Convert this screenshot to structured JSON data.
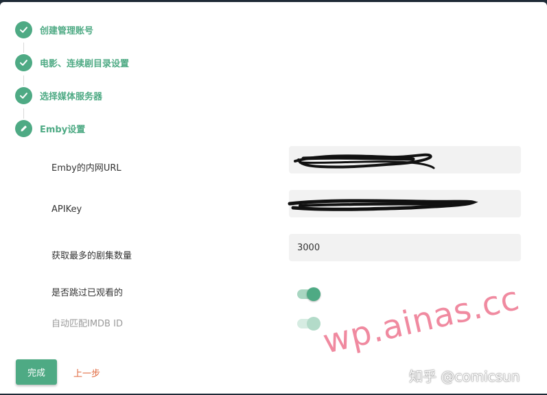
{
  "steps": [
    {
      "label": "创建管理账号",
      "icon": "check-icon"
    },
    {
      "label": "电影、连续剧目录设置",
      "icon": "check-icon"
    },
    {
      "label": "选择媒体服务器",
      "icon": "check-icon"
    },
    {
      "label": "Emby设置",
      "icon": "pencil-icon"
    }
  ],
  "fields": {
    "url": {
      "label": "Emby的内网URL",
      "value": ""
    },
    "apikey": {
      "label": "APIKey",
      "value": ""
    },
    "max_episodes": {
      "label": "获取最多的剧集数量",
      "value": "3000"
    }
  },
  "toggles": {
    "skip_watched": {
      "label": "是否跳过已观看的",
      "on": true
    },
    "auto_imdb": {
      "label": "自动匹配IMDB ID",
      "on": true,
      "disabled": true
    }
  },
  "buttons": {
    "done": "完成",
    "prev": "上一步"
  },
  "watermark": {
    "site": "wp.ainas.cc",
    "zhihu": "知乎 @comicsun"
  },
  "colors": {
    "accent": "#4eaa84",
    "link": "#e0673c",
    "watermark": "#f08aa0"
  }
}
